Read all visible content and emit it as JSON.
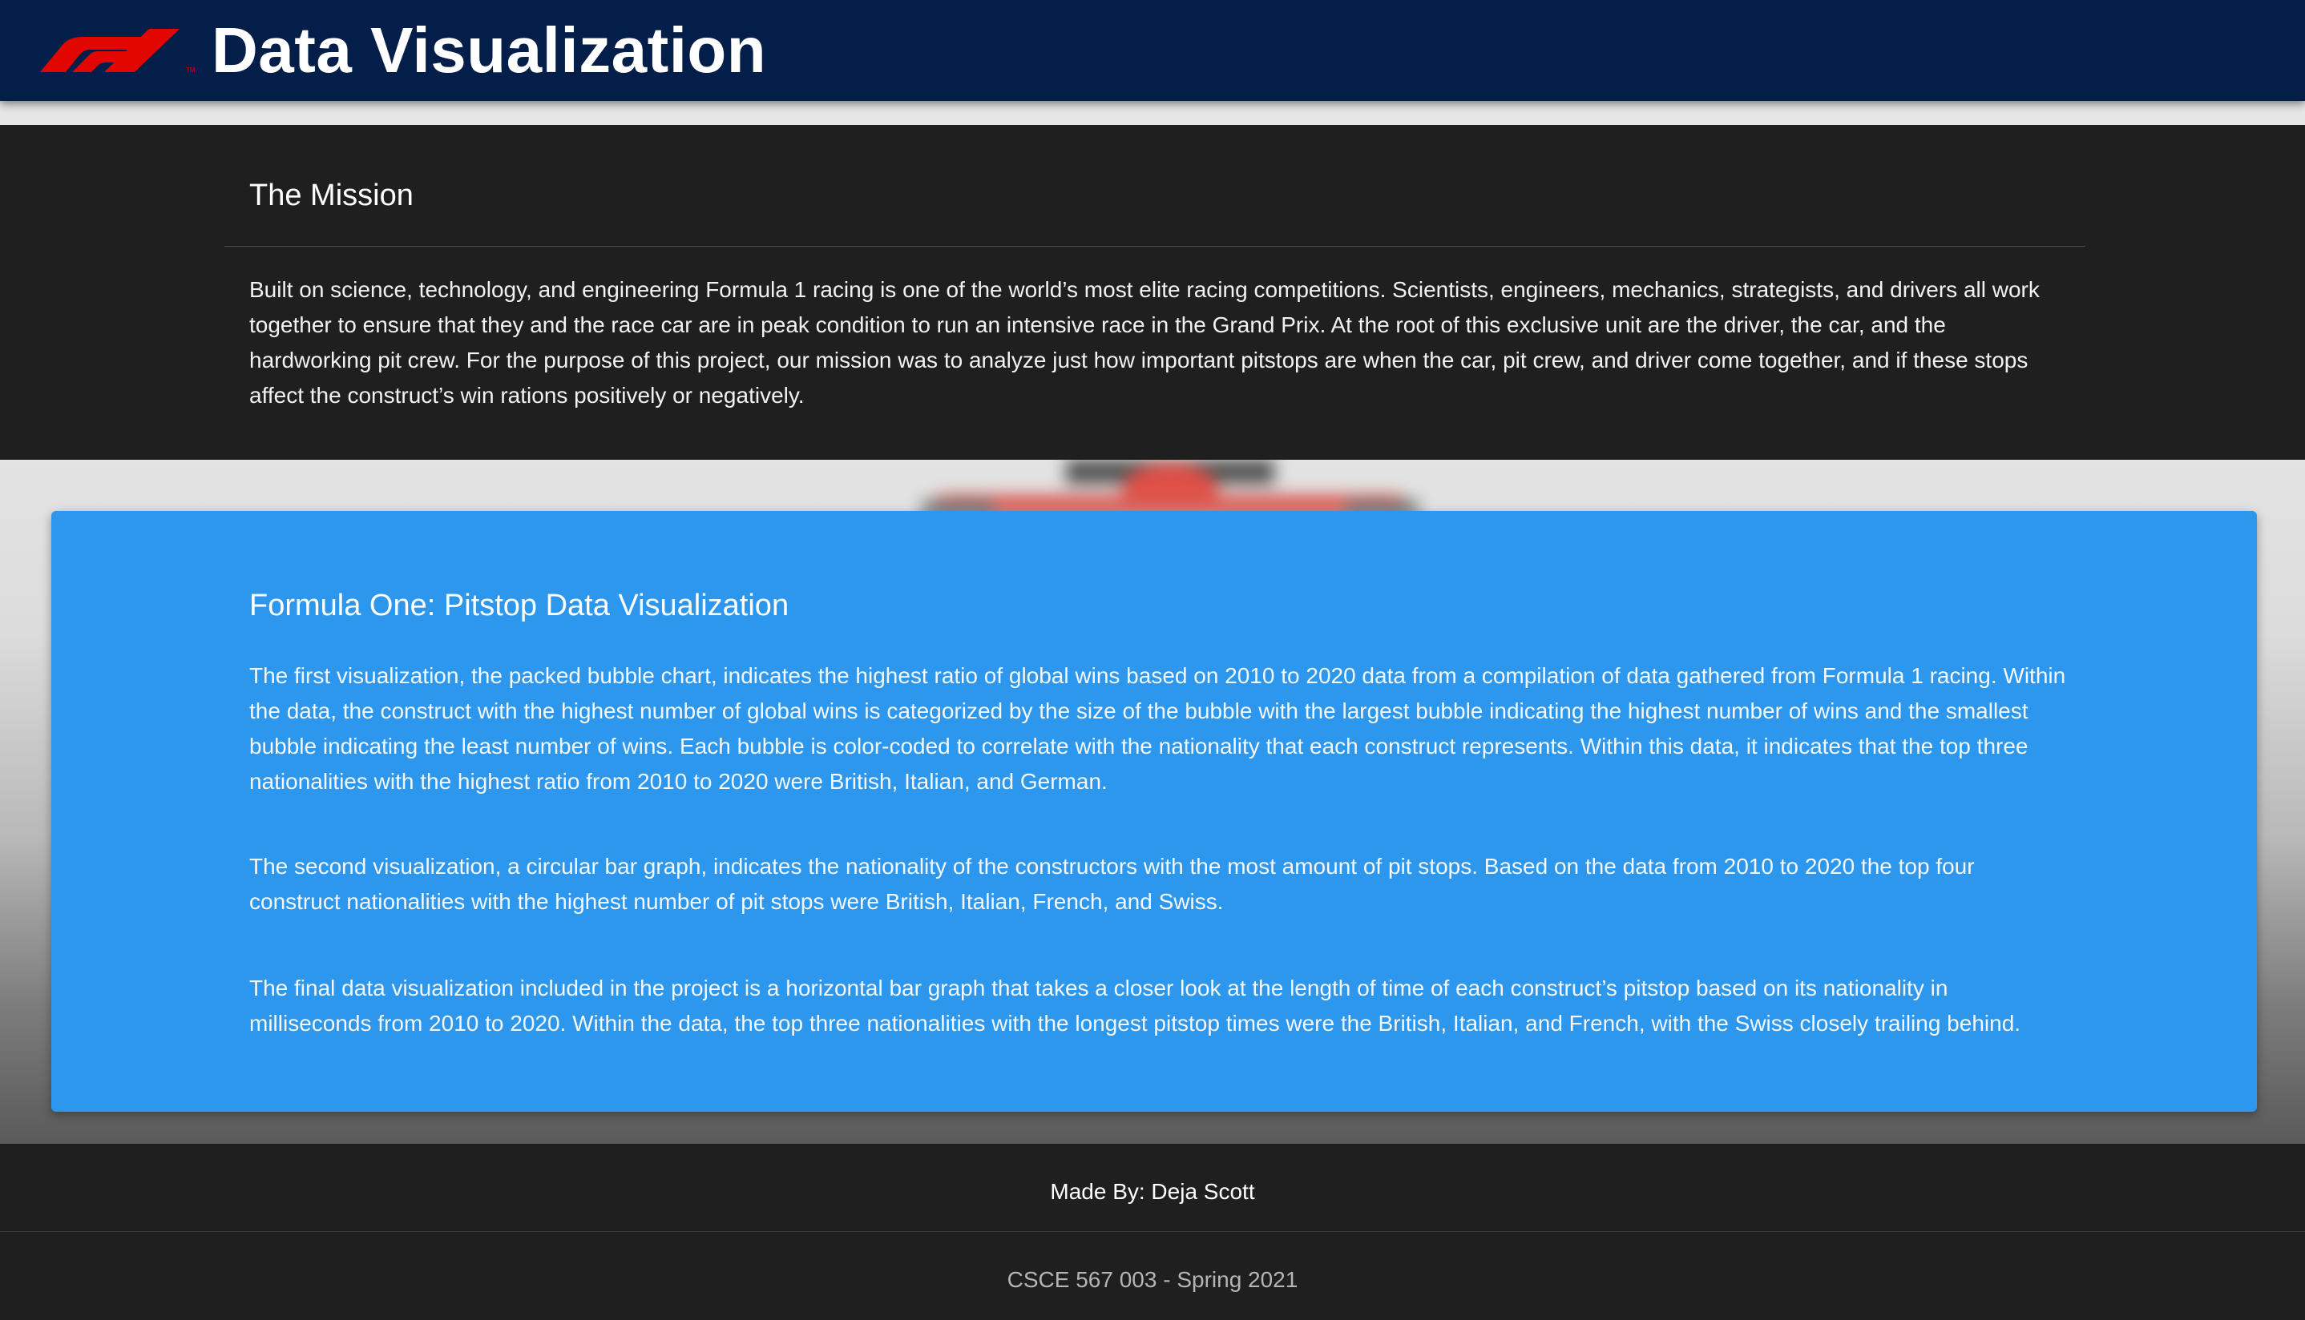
{
  "header": {
    "logo_icon": "f1-logo-icon",
    "title": "Data Visualization",
    "background_color": "#041e4a",
    "logo_color": "#e10600"
  },
  "mission": {
    "title": "The Mission",
    "text": "Built on science, technology, and engineering Formula 1 racing is one of the world’s most elite racing competitions. Scientists, engineers, mechanics, strategists, and drivers all work together to ensure that they and the race car are in peak condition to run an intensive race in the Grand Prix. At the root of this exclusive unit are the driver, the car, and the hardworking pit crew. For the purpose of this project, our mission was to analyze just how important pitstops are when the car, pit crew, and driver come together, and if these stops affect the construct’s win rations positively or negatively."
  },
  "card": {
    "title": "Formula One: Pitstop Data Visualization",
    "accent_color": "#2d97ee",
    "paragraphs": [
      "The first visualization, the packed bubble chart, indicates the highest ratio of global wins based on 2010 to 2020 data from a compilation of data gathered from Formula 1 racing. Within the data, the construct with the highest number of global wins is categorized by the size of the bubble with the largest bubble indicating the highest number of wins and the smallest bubble indicating the least number of wins. Each bubble is color-coded to correlate with the nationality that each construct represents. Within this data, it indicates that the top three nationalities with the highest ratio from 2010 to 2020 were British, Italian, and German.",
      "The second visualization, a circular bar graph, indicates the nationality of the constructors with the most amount of pit stops. Based on the data from 2010 to 2020 the top four construct nationalities with the highest number of pit stops were British, Italian, French, and Swiss.",
      "The final data visualization included in the project is a horizontal bar graph that takes a closer look at the length of time of each construct’s pitstop based on its nationality in milliseconds from 2010 to 2020. Within the data, the top three nationalities with the longest pitstop times were the British, Italian, and French, with the Swiss closely trailing behind."
    ]
  },
  "footer": {
    "author": "Made By: Deja Scott",
    "course": "CSCE 567 003 - Spring 2021"
  }
}
